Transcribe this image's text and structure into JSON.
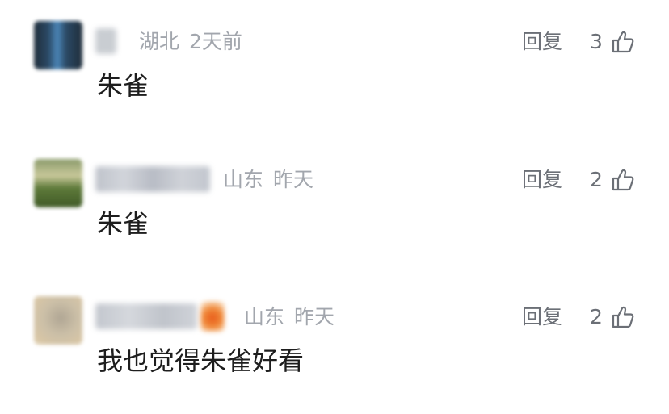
{
  "comments": [
    {
      "location": "湖北",
      "time": "2天前",
      "reply_label": "回复",
      "like_count": "3",
      "text": "朱雀"
    },
    {
      "location": "山东",
      "time": "昨天",
      "reply_label": "回复",
      "like_count": "2",
      "text": "朱雀"
    },
    {
      "location": "山东",
      "time": "昨天",
      "reply_label": "回复",
      "like_count": "2",
      "text": "我也觉得朱雀好看"
    }
  ],
  "icons": {
    "like": "thumbs-up-icon"
  },
  "colors": {
    "meta_text": "#a2a6ad",
    "action_text": "#6b6f76",
    "content_text": "#1e1e1e"
  }
}
